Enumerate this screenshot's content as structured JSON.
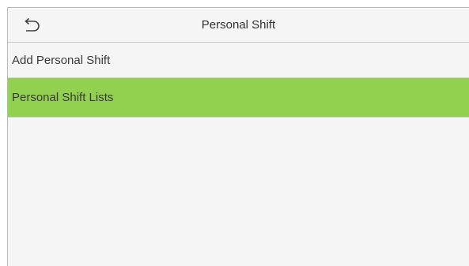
{
  "header": {
    "back_icon": "back-arrow-icon",
    "title": "Personal Shift"
  },
  "menu": {
    "items": [
      {
        "label": "Add Personal Shift",
        "selected": false
      },
      {
        "label": "Personal Shift Lists",
        "selected": true
      }
    ]
  },
  "colors": {
    "selected_background": "#92d050",
    "screen_background": "#f5f5f5",
    "divider": "#d2d2d2"
  }
}
